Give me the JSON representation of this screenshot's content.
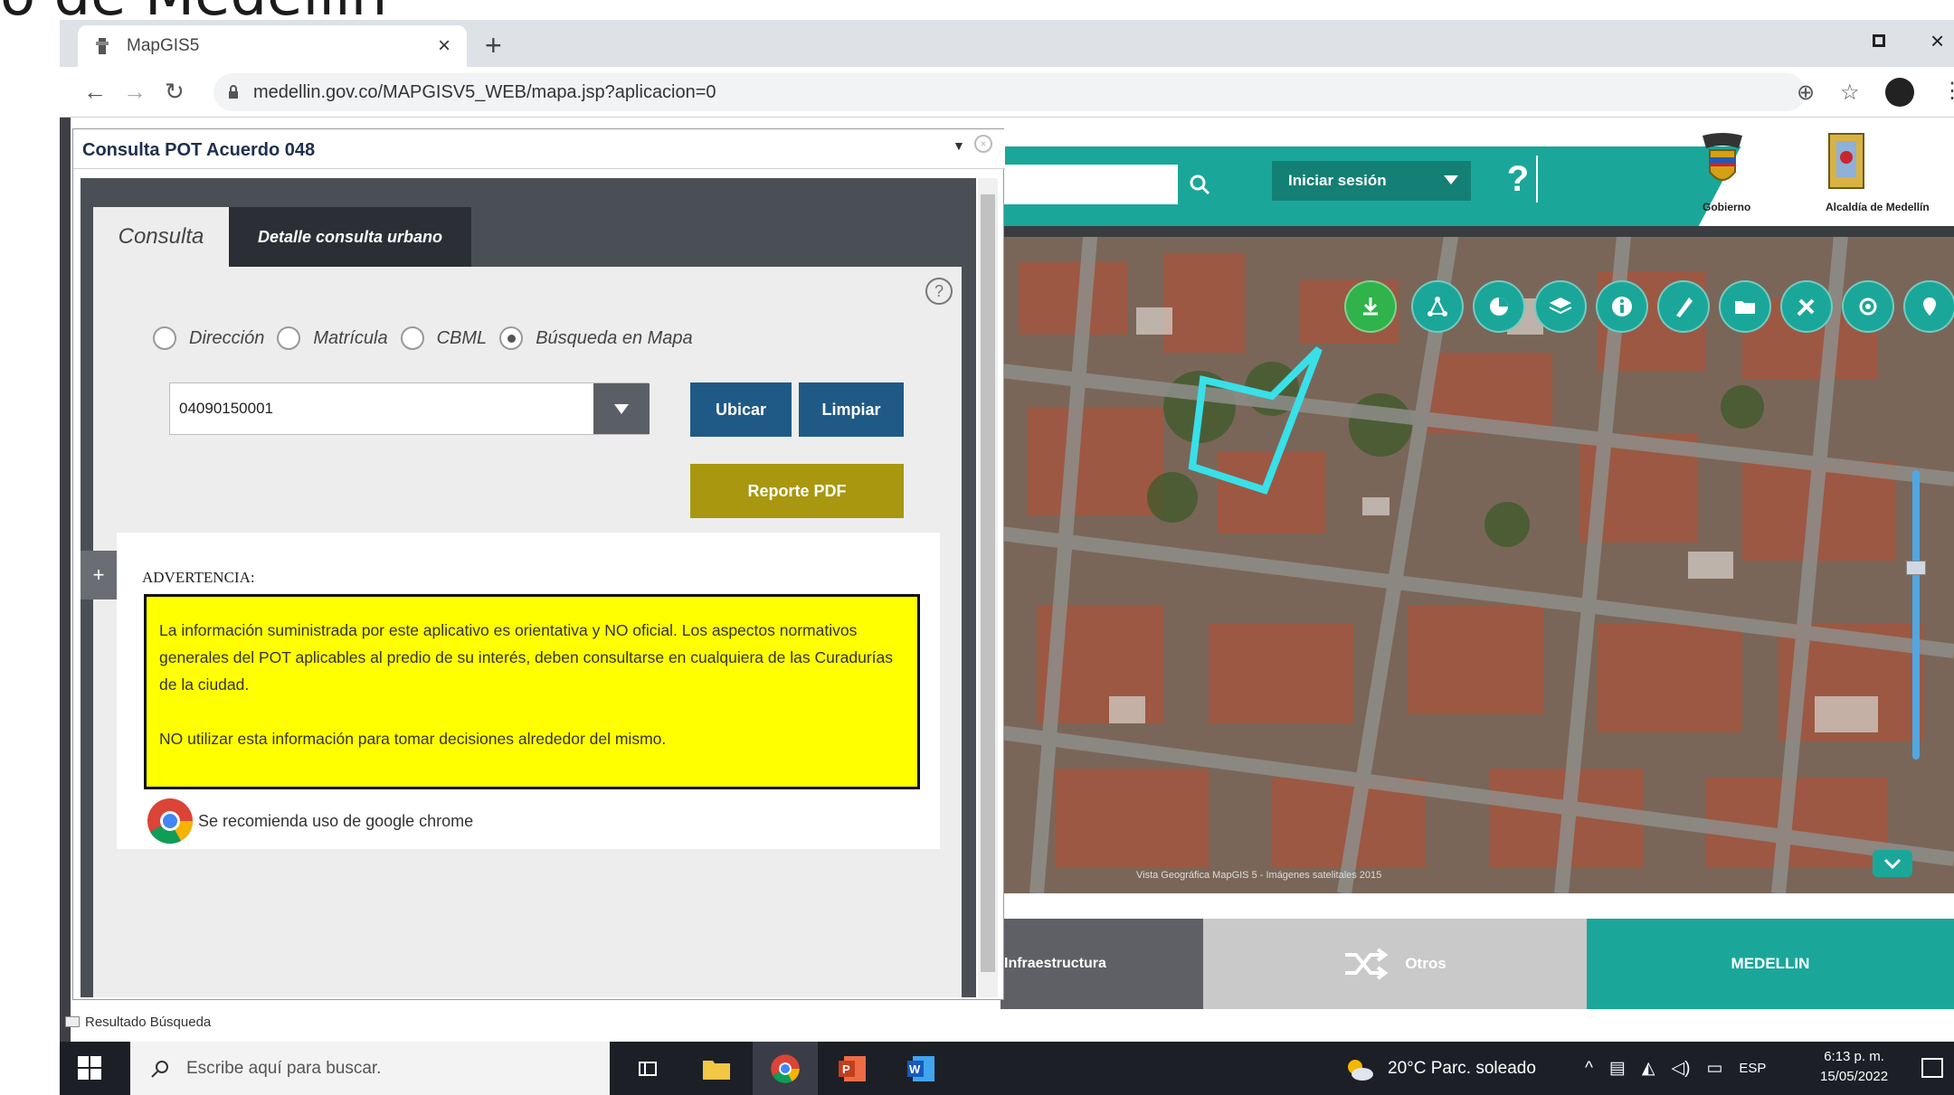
{
  "slide": {
    "title_fragment": "o de Medellín"
  },
  "browser": {
    "tab_title": "MapGIS5",
    "url": "medellin.gov.co/MAPGISV5_WEB/mapa.jsp?aplicacion=0"
  },
  "map_header": {
    "login_label": "Iniciar sesión",
    "help_label": "?",
    "logo1_caption": "Gobierno",
    "logo2_caption": "Alcaldía de Medellín"
  },
  "map": {
    "attribution": "Vista Geográfica MapGIS 5 - Imágenes satelitales 2015",
    "tools": [
      "download-icon",
      "network-icon",
      "pie-chart-icon",
      "layers-icon",
      "info-icon",
      "measure-icon",
      "folder-icon",
      "tools-icon",
      "locate-icon",
      "marker-icon"
    ]
  },
  "footer_tabs": {
    "tab1": "Infraestructura",
    "tab2": "Otros",
    "tab3": "MEDELLIN"
  },
  "dialog": {
    "title": "Consulta POT Acuerdo 048",
    "tabs": {
      "consulta": "Consulta",
      "detalle": "Detalle consulta urbano"
    },
    "radios": [
      {
        "label": "Dirección",
        "selected": false
      },
      {
        "label": "Matrícula",
        "selected": false
      },
      {
        "label": "CBML",
        "selected": false
      },
      {
        "label": "Búsqueda en Mapa",
        "selected": true
      }
    ],
    "cbml_value": "04090150001",
    "buttons": {
      "ubicar": "Ubicar",
      "limpiar": "Limpiar",
      "pdf": "Reporte PDF"
    },
    "warning_title": "ADVERTENCIA:",
    "warning_p1": "La información suministrada por este aplicativo es orientativa y NO oficial. Los aspectos normativos generales del POT aplicables al predio de su interés, deben consultarse en cualquiera de las Curadurías de la ciudad.",
    "warning_p2": "NO utilizar esta información para tomar decisiones alrededor del mismo.",
    "chrome_note": "Se recomienda uso de google chrome"
  },
  "status": {
    "resultado": "Resultado Búsqueda"
  },
  "taskbar": {
    "search_placeholder": "Escribe aquí para buscar.",
    "weather": "20°C  Parc. soleado",
    "lang": "ESP",
    "time": "6:13 p. m.",
    "date": "15/05/2022"
  },
  "colors": {
    "teal": "#1aa79a",
    "navy_button": "#1f5a86",
    "olive_button": "#a8970f",
    "warning_yellow": "#ffff00",
    "parcel_outline": "#38e0e8"
  }
}
